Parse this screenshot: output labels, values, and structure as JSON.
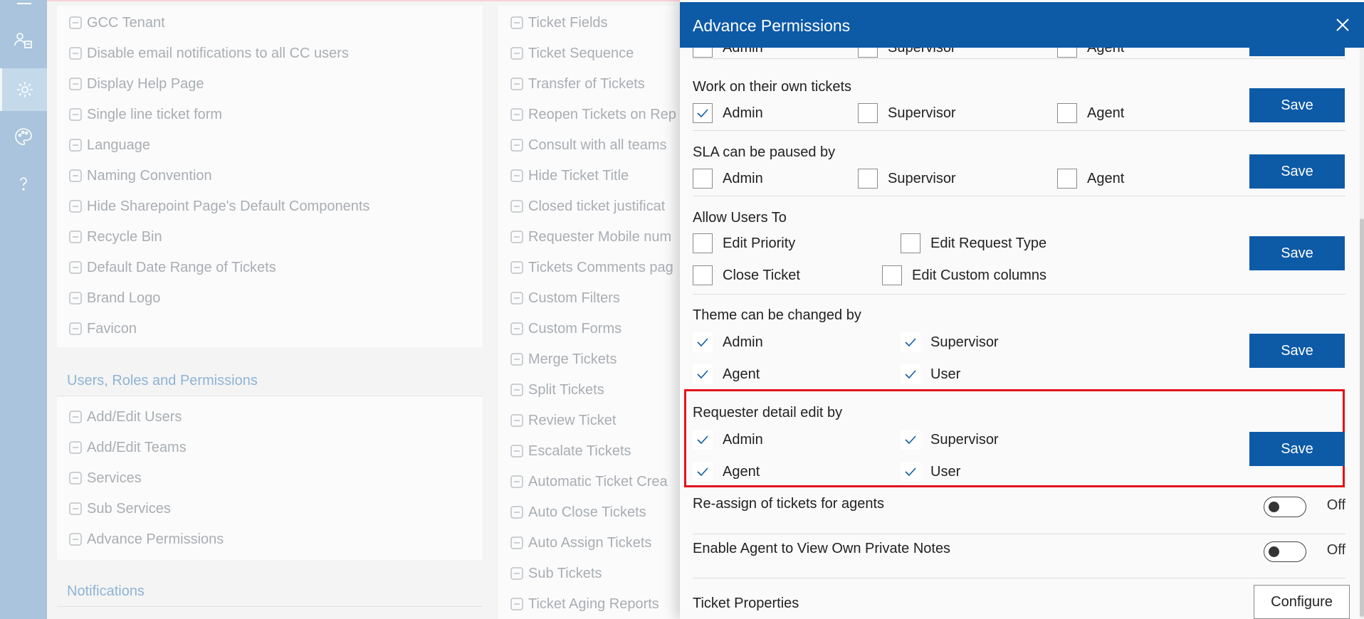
{
  "background": {
    "general_items": [
      {
        "label": "GCC Tenant",
        "icon": "globe-icon"
      },
      {
        "label": "Disable email notifications to all CC users",
        "icon": "globe-icon"
      },
      {
        "label": "Display Help Page",
        "icon": "question-icon"
      },
      {
        "label": "Single line ticket form",
        "icon": "person-cancel-icon"
      },
      {
        "label": "Language",
        "icon": "translate-icon"
      },
      {
        "label": "Naming Convention",
        "icon": "rename-icon"
      },
      {
        "label": "Hide Sharepoint Page's Default Components",
        "icon": "page-icon"
      },
      {
        "label": "Recycle Bin",
        "icon": "recycle-bin-icon"
      },
      {
        "label": "Default Date Range of Tickets",
        "icon": "calendar-clock-icon"
      },
      {
        "label": "Brand Logo",
        "icon": "badge-icon"
      },
      {
        "label": "Favicon",
        "icon": "favicon-icon"
      }
    ],
    "users_section_title": "Users, Roles and Permissions",
    "users_items": [
      {
        "label": "Add/Edit Users",
        "icon": "people-icon"
      },
      {
        "label": "Add/Edit Teams",
        "icon": "team-icon"
      },
      {
        "label": "Services",
        "icon": "list-icon"
      },
      {
        "label": "Sub Services",
        "icon": "sublist-icon"
      },
      {
        "label": "Advance Permissions",
        "icon": "key-icon"
      }
    ],
    "notifications_section_title": "Notifications",
    "ticket_items": [
      {
        "label": "Ticket Fields",
        "icon": "fields-icon"
      },
      {
        "label": "Ticket Sequence",
        "icon": "sequence-icon"
      },
      {
        "label": "Transfer of Tickets",
        "icon": "transfer-icon"
      },
      {
        "label": "Reopen Tickets on Rep",
        "icon": "reopen-icon"
      },
      {
        "label": "Consult with all teams",
        "icon": "consult-icon"
      },
      {
        "label": "Hide Ticket Title",
        "icon": "hide-title-icon"
      },
      {
        "label": "Closed ticket justificat",
        "icon": "edit-note-icon"
      },
      {
        "label": "Requester Mobile num",
        "icon": "person-icon"
      },
      {
        "label": "Tickets Comments pag",
        "icon": "comments-page-icon"
      },
      {
        "label": "Custom Filters",
        "icon": "filter-icon"
      },
      {
        "label": "Custom Forms",
        "icon": "layers-icon"
      },
      {
        "label": "Merge Tickets",
        "icon": "merge-icon"
      },
      {
        "label": "Split Tickets",
        "icon": "split-icon"
      },
      {
        "label": "Review Ticket",
        "icon": "review-icon"
      },
      {
        "label": "Escalate Tickets",
        "icon": "escalate-icon"
      },
      {
        "label": "Automatic Ticket Crea",
        "icon": "auto-create-icon"
      },
      {
        "label": "Auto Close Tickets",
        "icon": "auto-close-icon"
      },
      {
        "label": "Auto Assign Tickets",
        "icon": "auto-assign-icon"
      },
      {
        "label": "Sub Tickets",
        "icon": "sub-tickets-icon"
      },
      {
        "label": "Ticket Aging Reports",
        "icon": "checkbox-icon"
      }
    ]
  },
  "panel": {
    "title": "Advance Permissions",
    "save_label": "Save",
    "top_partial": {
      "opt1": "Admin",
      "opt2": "Supervisor",
      "opt3": "Agent"
    },
    "own_tickets": {
      "title": "Work on their own tickets",
      "opt1": "Admin",
      "opt2": "Supervisor",
      "opt3": "Agent"
    },
    "sla_paused": {
      "title": "SLA can be paused by",
      "opt1": "Admin",
      "opt2": "Supervisor",
      "opt3": "Agent"
    },
    "allow_users": {
      "title": "Allow Users To",
      "opt1": "Edit Priority",
      "opt2": "Edit Request Type",
      "opt3": "Close Ticket",
      "opt4": "Edit Custom columns"
    },
    "theme": {
      "title": "Theme can be changed by",
      "opt1": "Admin",
      "opt2": "Supervisor",
      "opt3": "Agent",
      "opt4": "User"
    },
    "requester_edit": {
      "title": "Requester detail edit by",
      "opt1": "Admin",
      "opt2": "Supervisor",
      "opt3": "Agent",
      "opt4": "User"
    },
    "reassign": {
      "title": "Re-assign of tickets for agents",
      "state": "Off"
    },
    "private_notes": {
      "title": "Enable Agent to View Own Private Notes",
      "state": "Off"
    },
    "ticket_properties": {
      "title": "Ticket Properties",
      "button": "Configure"
    }
  },
  "colors": {
    "brand": "#0d5aa7",
    "highlight": "#e2121b"
  }
}
